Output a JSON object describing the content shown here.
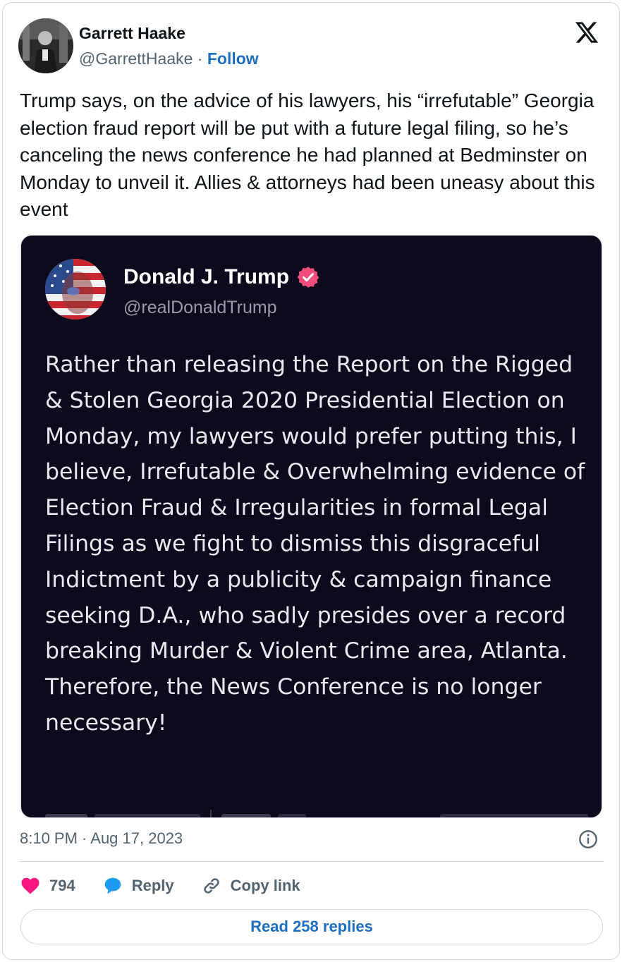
{
  "author": {
    "name": "Garrett Haake",
    "handle": "@GarrettHaake",
    "separator": "·",
    "follow_label": "Follow"
  },
  "tweet": {
    "text": "Trump says, on the advice of his lawyers, his “irrefutable” Georgia election fraud report will be put with a future legal filing, so he’s canceling the news conference he had planned at Bedminster on Monday to unveil it. Allies & attorneys had been uneasy about this event",
    "timestamp": "8:10 PM · Aug 17, 2023"
  },
  "embed": {
    "name": "Donald J. Trump",
    "handle": "@realDonaldTrump",
    "text": "Rather than releasing the Report on the Rigged & Stolen Georgia 2020 Presidential Election on Monday, my lawyers would prefer putting this, I believe, Irrefutable & Overwhelming evidence of Election Fraud & Irregularities in formal Legal Filings as we fight to dismiss this disgraceful Indictment by a publicity & campaign finance seeking D.A., who sadly presides over a record breaking Murder & Violent Crime area, Atlanta. Therefore, the News Conference is no longer necessary!",
    "verified_color": "#f04d7a"
  },
  "actions": {
    "like_count": "794",
    "reply_label": "Reply",
    "copy_label": "Copy link"
  },
  "read_replies_label": "Read 258 replies",
  "colors": {
    "like": "#f91880",
    "reply": "#1d9bf0",
    "link_blue": "#1d6fc1",
    "embed_bg": "#0c0a1c"
  },
  "icons": [
    "x-logo-icon",
    "info-icon",
    "heart-icon",
    "reply-bubble-icon",
    "link-icon",
    "verified-badge-icon"
  ]
}
